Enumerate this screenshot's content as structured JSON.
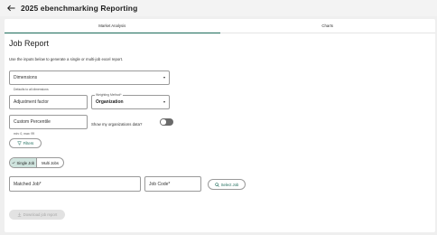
{
  "header": {
    "title": "2025 ebenchmarking Reporting",
    "back_icon": "arrow-left-icon"
  },
  "tabs": [
    {
      "label": "Market Analysis",
      "active": true
    },
    {
      "label": "Charts",
      "active": false
    }
  ],
  "page": {
    "title": "Job Report",
    "instruction": "Use the inputs below to generate a single or multi-job excel report."
  },
  "dimensions": {
    "value": "Dimensions",
    "helper": "Defaults to all dimensions"
  },
  "adjustment_factor": {
    "placeholder": "Adjustment factor",
    "value": ""
  },
  "weighting_method": {
    "label": "Weighting Method*",
    "value": "Organization"
  },
  "custom_percentile": {
    "placeholder": "Custom Percentile",
    "value": "",
    "helper": "min: 0, max: 99"
  },
  "toggle": {
    "label": "Show my organizations data?",
    "on": false
  },
  "filters": {
    "label": "Filters",
    "icon": "filter-icon"
  },
  "job_mode": {
    "options": [
      "Single Job",
      "Multi Jobs"
    ],
    "selected": "Single Job",
    "check_icon": "check-icon"
  },
  "matched_job": {
    "placeholder": "Matched Job*",
    "value": ""
  },
  "job_code": {
    "placeholder": "Job Code*",
    "value": ""
  },
  "select_job": {
    "label": "Select Job",
    "icon": "search-icon"
  },
  "download": {
    "label": "Download job report",
    "icon": "download-icon",
    "disabled": true
  },
  "colors": {
    "accent": "#1c6b5a",
    "selected_bg": "#cfe4de",
    "toggle_off": "#6a6a6a"
  }
}
